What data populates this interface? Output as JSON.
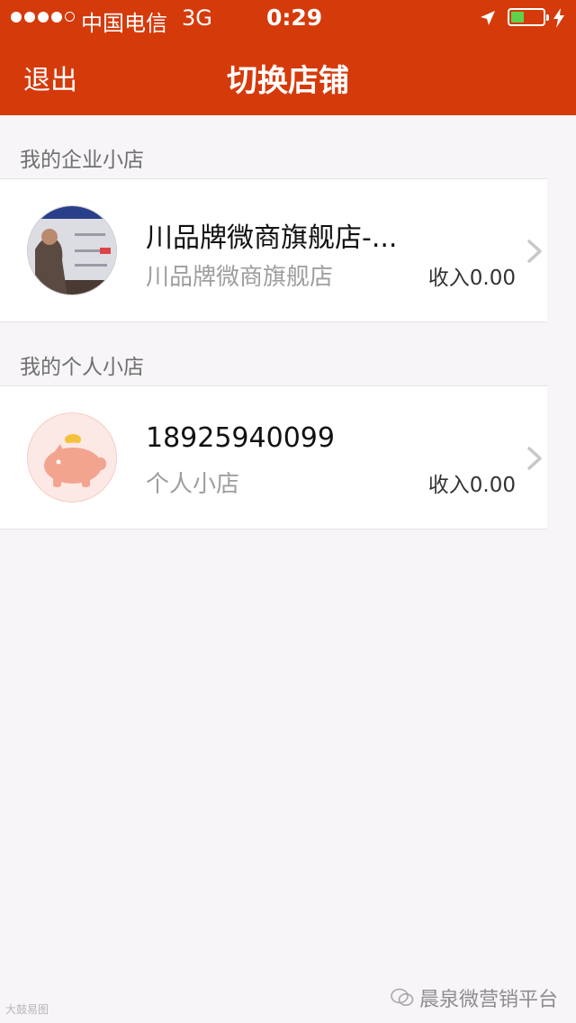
{
  "status_bar": {
    "carrier": "中国电信",
    "network": "3G",
    "time": "0:29",
    "battery_level": 0.4
  },
  "nav": {
    "back_label": "退出",
    "title": "切换店铺"
  },
  "sections": [
    {
      "header": "我的企业小店",
      "store": {
        "name": "川品牌微商旗舰店-...",
        "subtitle": "川品牌微商旗舰店",
        "income": "收入0.00"
      }
    },
    {
      "header": "我的个人小店",
      "store": {
        "name": "18925940099",
        "subtitle": "个人小店",
        "income": "收入0.00"
      }
    }
  ],
  "watermark": {
    "left": "大鼓易图",
    "right": "晨泉微营销平台"
  },
  "colors": {
    "accent": "#d53a0b",
    "background": "#f7f5f8"
  }
}
